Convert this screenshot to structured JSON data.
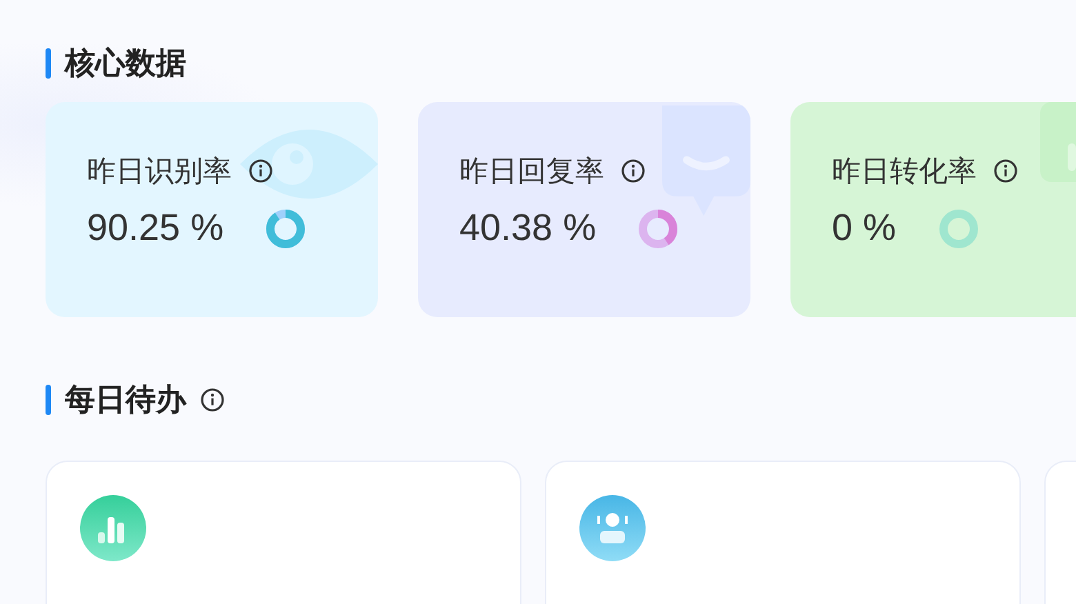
{
  "core_section": {
    "title": "核心数据"
  },
  "stats": [
    {
      "label": "昨日识别率",
      "value": "90.25 %",
      "level": 0.9025,
      "color": "#9fd0fb",
      "kind": "eye"
    },
    {
      "label": "昨日回复率",
      "value": "40.38 %",
      "level": 0.4038,
      "color": "#dcb4ef",
      "kind": "chat"
    },
    {
      "label": "昨日转化率",
      "value": "0 %",
      "level": 0,
      "color": "#9fe6cf",
      "kind": "chart"
    }
  ],
  "todo_section": {
    "title": "每日待办"
  },
  "todos": [
    {
      "kind": "chart"
    },
    {
      "kind": "agent"
    },
    {
      "kind": "blank"
    }
  ]
}
